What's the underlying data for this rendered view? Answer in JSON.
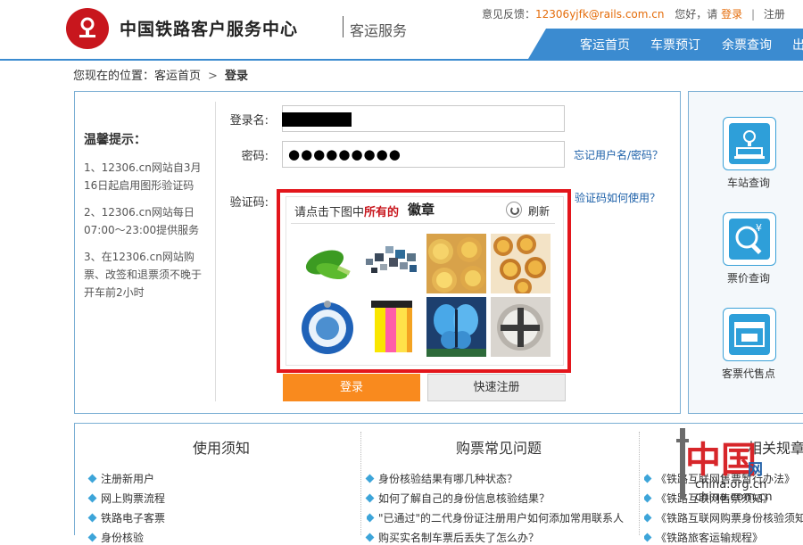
{
  "header": {
    "site_title": "中国铁路客户服务中心",
    "site_subtitle": "客运服务",
    "feedback_label": "意见反馈：",
    "feedback_email": "12306yjfk@rails.com.cn",
    "greeting": "您好，请",
    "login_link": "登录",
    "register_link": "注册",
    "nav": [
      "客运首页",
      "车票预订",
      "余票查询",
      "出"
    ]
  },
  "breadcrumb": {
    "prefix": "您现在的位置：",
    "home": "客运首页",
    "separator": ">",
    "current": "登录"
  },
  "tips": {
    "title": "温馨提示：",
    "items": [
      "1、12306.cn网站自3月16日起启用图形验证码",
      "2、12306.cn网站每日07:00～23:00提供服务",
      "3、在12306.cn网站购票、改签和退票须不晚于开车前2小时"
    ]
  },
  "form": {
    "username_label": "登录名:",
    "password_label": "密码:",
    "password_value": "●●●●●●●●●",
    "forgot_link": "忘记用户名/密码？",
    "captcha_label": "验证码:",
    "captcha_help_link": "验证码如何使用？",
    "login_button": "登录",
    "quick_register_button": "快速注册"
  },
  "captcha": {
    "prompt_prefix": "请点击下图中",
    "prompt_emphasis": "所有的",
    "target": "徽章",
    "refresh_label": "刷新",
    "images": [
      "green-vegetable",
      "photo-wall",
      "egg-tarts",
      "egg-tarts-tray",
      "blue-badge",
      "sticky-notes",
      "butterfly",
      "silver-badge"
    ]
  },
  "side": {
    "items": [
      {
        "label": "车站查询",
        "icon": "station-icon"
      },
      {
        "label": "票价查询",
        "icon": "price-search-icon"
      },
      {
        "label": "客票代售点",
        "icon": "ticket-agent-icon"
      }
    ]
  },
  "bottom": {
    "columns": [
      {
        "title": "使用须知",
        "items": [
          "注册新用户",
          "网上购票流程",
          "铁路电子客票",
          "身份核验"
        ]
      },
      {
        "title": "购票常见问题",
        "items": [
          "身份核验结果有哪几种状态？",
          "如何了解自己的身份信息核验结果？",
          "\"已通过\"的二代身份证注册用户如何添加常用联系人",
          "购买实名制车票后丢失了怎么办？"
        ]
      },
      {
        "title": "相关规章",
        "items": [
          "《铁路互联网售票暂行办法》",
          "《铁路互联网售票须知》",
          "《铁路互联网购票身份核验须知》",
          "《铁路旅客运输规程》"
        ]
      }
    ]
  },
  "watermark": {
    "brand_cn": "中国",
    "brand_net": "网",
    "url1": "china.org.cn",
    "url2": "china.com.cn"
  },
  "colors": {
    "brand_red": "#c8161d",
    "nav_blue": "#3b8bd0",
    "login_orange": "#f98a1e",
    "link_blue": "#1b5fa8"
  }
}
